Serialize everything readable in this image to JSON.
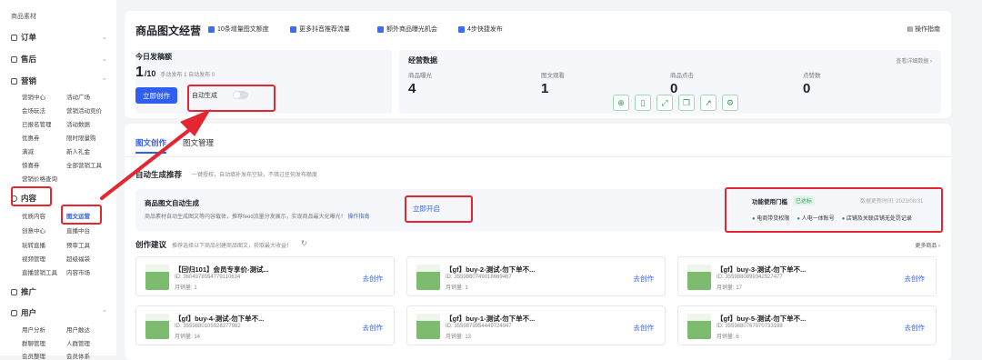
{
  "sidebar": {
    "top_item": "商品素材",
    "sections": [
      {
        "label": "订单"
      },
      {
        "label": "售后"
      },
      {
        "label": "营销"
      },
      {
        "label": "内容"
      },
      {
        "label": "推广"
      },
      {
        "label": "用户"
      }
    ],
    "marketing_items": [
      "营销中心",
      "活动广场",
      "会场玩法",
      "营销活动竞价",
      "已报名管理",
      "活动数据",
      "优惠券",
      "限时限量购",
      "满减",
      "新人礼金",
      "惊喜券",
      "全部营销工具",
      "营销价格查询"
    ],
    "content_items": [
      "优质内容",
      "图文运营",
      "创意中心",
      "直播中台",
      "玩转直播",
      "预审工具",
      "视频管理",
      "超级福袋",
      "直播营销工具",
      "内容市场"
    ],
    "user_items": [
      "用户分析",
      "用户触达",
      "群聊管理",
      "人群管理",
      "会员整理",
      "会员体系"
    ]
  },
  "header": {
    "title": "商品图文经营",
    "pills": [
      "10条增量图文额度",
      "更多抖音推荐流量",
      "额外商品曝光机会",
      "4步快捷发布"
    ],
    "help": "操作指南"
  },
  "quota": {
    "label": "今日发稿额",
    "value": "1",
    "total": "/10",
    "detail": "手动发布 1  自动发布 0",
    "create_button": "立即创作",
    "auto_label": "自动生成"
  },
  "stats": {
    "title": "经营数据",
    "link": "查看详细数据 ›",
    "items": [
      {
        "label": "商品曝光",
        "value": "4"
      },
      {
        "label": "图文观看",
        "value": "1"
      },
      {
        "label": "商品点击",
        "value": "0"
      },
      {
        "label": "点赞数",
        "value": "0"
      }
    ]
  },
  "tabs": {
    "active": "图文创作",
    "second": "图文管理"
  },
  "auto_section": {
    "title": "自动生成推荐",
    "desc": "一键授权，自动填补发布空缺，不错过任何发布额度",
    "box_title": "商品图文自动生成",
    "box_desc": "商品素材自动生成图文等内容载体，推荐feed流量分发展示，实现商品最大化曝光！",
    "box_link": "操作指南",
    "enable": "立即开启",
    "threshold_label": "功能使用门槛",
    "threshold_badge": "已达标",
    "update_time": "数据更新时间: 2023/08/31",
    "checks": [
      "电商带货权限",
      "人电一体账号",
      "店铺及关联店铺无处罚记录"
    ]
  },
  "suggest": {
    "title": "创作建议",
    "desc": "推荐选择以下商品创建商品图文，获取最大收益！",
    "more": "更多商品 ›",
    "cards": [
      {
        "title": "【回归101】会员专享价-测试...",
        "id": "ID: 3604978554779110634",
        "sales": "月销量: 1",
        "action": "去创作"
      },
      {
        "title": "【gf】buy-2-测试-勿下单不...",
        "id": "ID: 3559880749018669467",
        "sales": "月销量: 1",
        "action": "去创作"
      },
      {
        "title": "【gf】buy-3-测试-勿下单不...",
        "id": "ID: 3559880899342527477",
        "sales": "月销量: 17",
        "action": "去创作"
      },
      {
        "title": "【gf】buy-4-测试-勿下单不...",
        "id": "ID: 3559880105928277982",
        "sales": "月销量: 14",
        "action": "去创作"
      },
      {
        "title": "【gf】buy-1-测试-勿下单不...",
        "id": "ID: 3559879954449724947",
        "sales": "月销量: 13",
        "action": "去创作"
      },
      {
        "title": "【gf】buy-5-测试-勿下单不...",
        "id": "ID: 3559880767070733198",
        "sales": "月销量: 6",
        "action": "去创作"
      }
    ]
  },
  "toolbar_icons": [
    "zoom-icon",
    "crop-icon",
    "expand-icon",
    "copy-icon",
    "share-icon",
    "settings-icon"
  ],
  "colors": {
    "accent": "#2f5ef0",
    "highlight": "#e3262f",
    "success": "#2b9a5b"
  }
}
